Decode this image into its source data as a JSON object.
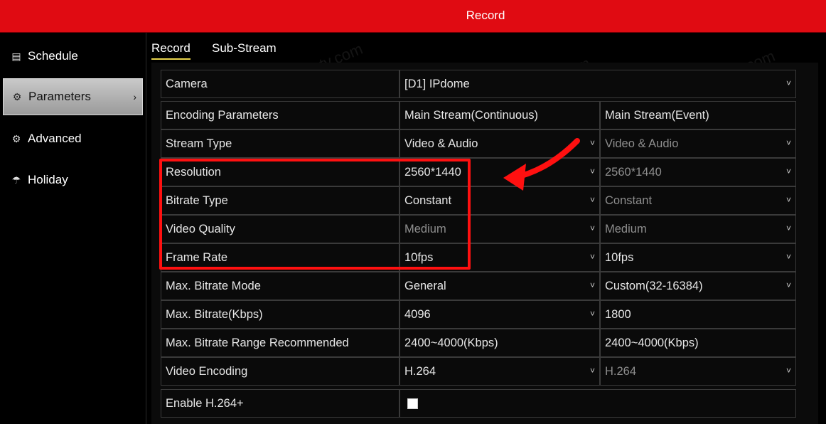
{
  "window": {
    "title": "Record"
  },
  "sidebar": {
    "items": [
      {
        "label": "Schedule",
        "icon": "calendar-icon",
        "active": false
      },
      {
        "label": "Parameters",
        "icon": "gear-icon",
        "active": true
      },
      {
        "label": "Advanced",
        "icon": "advanced-gear-icon",
        "active": false
      },
      {
        "label": "Holiday",
        "icon": "umbrella-icon",
        "active": false
      }
    ]
  },
  "tabs": [
    {
      "label": "Record",
      "active": true
    },
    {
      "label": "Sub-Stream",
      "active": false
    }
  ],
  "camera": {
    "label": "Camera",
    "value": "[D1] IPdome"
  },
  "table": {
    "header": {
      "label": "Encoding Parameters",
      "main": "Main Stream(Continuous)",
      "event": "Main Stream(Event)"
    },
    "rows": [
      {
        "label": "Stream Type",
        "main": "Video & Audio",
        "event": "Video & Audio"
      },
      {
        "label": "Resolution",
        "main": "2560*1440",
        "event": "2560*1440"
      },
      {
        "label": "Bitrate Type",
        "main": "Constant",
        "event": "Constant"
      },
      {
        "label": "Video Quality",
        "main": "Medium",
        "event": "Medium"
      },
      {
        "label": "Frame Rate",
        "main": "10fps",
        "event": "10fps"
      },
      {
        "label": "Max. Bitrate Mode",
        "main": "General",
        "event": "Custom(32-16384)"
      },
      {
        "label": "Max. Bitrate(Kbps)",
        "main": "4096",
        "event": "1800"
      },
      {
        "label": "Max. Bitrate Range Recommended",
        "main": "2400~4000(Kbps)",
        "event": "2400~4000(Kbps)"
      },
      {
        "label": "Video Encoding",
        "main": "H.264",
        "event": "H.264"
      }
    ]
  },
  "h264plus": {
    "label": "Enable H.264+",
    "checked": false
  },
  "watermark": "learncctv.com",
  "colors": {
    "title_bar": "#e00b12",
    "highlight": "#ff1010",
    "tab_underline": "#e8d44d"
  }
}
